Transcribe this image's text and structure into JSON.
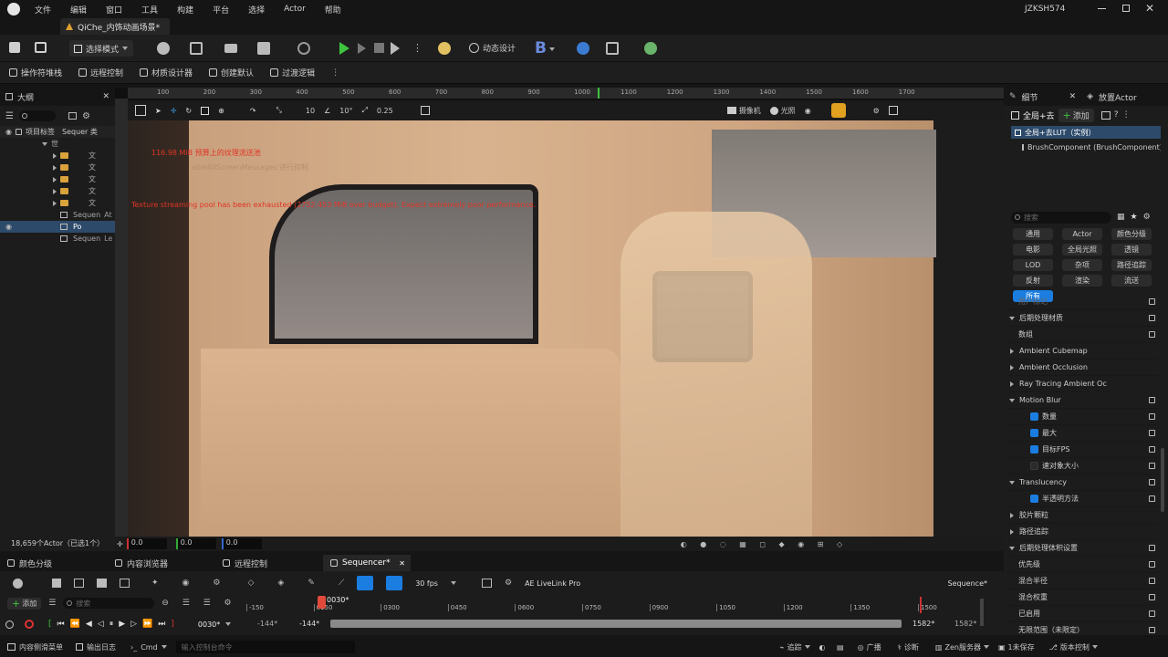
{
  "menu": [
    "文件",
    "编辑",
    "窗口",
    "工具",
    "构建",
    "平台",
    "选择",
    "Actor",
    "帮助"
  ],
  "user": "JZKSH574",
  "level_tab": "QiChe_内饰动画场景*",
  "toolbar1": {
    "mode": "选择模式",
    "dynamic_design": "动态设计"
  },
  "toolbar2": [
    "操作符堆栈",
    "远程控制",
    "材质设计器",
    "创建默认",
    "过渡逻辑"
  ],
  "outliner": {
    "title": "大纲",
    "col_label": "项目标签",
    "col_type": "Sequer 类",
    "rows": [
      {
        "label": "世",
        "indent": 0
      },
      {
        "label": "文",
        "indent": 1,
        "folder": true
      },
      {
        "label": "文",
        "indent": 1,
        "folder": true
      },
      {
        "label": "文",
        "indent": 1,
        "folder": true
      },
      {
        "label": "文",
        "indent": 1,
        "folder": true
      },
      {
        "label": "文",
        "indent": 1,
        "folder": true
      },
      {
        "label": "Sequen",
        "type": "At",
        "indent": 1
      },
      {
        "label": "Po",
        "indent": 1,
        "selected": true
      },
      {
        "label": "Sequen",
        "type": "Le",
        "indent": 1
      }
    ],
    "footer": "18,659个Actor（已选1个）"
  },
  "viewport": {
    "ruler": [
      "100",
      "200",
      "300",
      "400",
      "500",
      "600",
      "700",
      "800",
      "900",
      "1000",
      "1100",
      "1200",
      "1300",
      "1400",
      "1500",
      "1600",
      "1700"
    ],
    "camera_label": "摄像机",
    "lit_label": "光照",
    "snap_rot": "10°",
    "snap_grid": "10",
    "snap_scale": "0.25",
    "msg1": "116.98 MiB 预算上的纹理流送池",
    "msg2": "ableAllScreenMessages'进行抑制",
    "msg3": "Texture streaming pool has been exhausted (2752.453 MiB over budget). Expect extremely poor performance.",
    "coord_x": "0.0",
    "coord_y": "0.0",
    "coord_z": "0.0"
  },
  "details": {
    "tab1": "细节",
    "tab2": "放置Actor",
    "search_prefix": "全局+去",
    "add_label": "添加",
    "selected_item": "全局+去LUT（实例）",
    "component": "BrushComponent (BrushComponent)",
    "search_placeholder": "搜索",
    "chips": [
      "通用",
      "Actor",
      "颜色分级",
      "电影",
      "全局光照",
      "透镜",
      "LOD",
      "杂项",
      "路径追踪",
      "反射",
      "渲染",
      "流送",
      "所有"
    ],
    "props": [
      {
        "label": "用户标记",
        "kind": "plain",
        "dim": true
      },
      {
        "label": "后期处理材质",
        "kind": "section"
      },
      {
        "label": "数组",
        "kind": "plain"
      },
      {
        "label": "Ambient Cubemap",
        "kind": "collapsed"
      },
      {
        "label": "Ambient Occlusion",
        "kind": "collapsed"
      },
      {
        "label": "Ray Tracing Ambient Oc",
        "kind": "collapsed"
      },
      {
        "label": "Motion Blur",
        "kind": "section"
      },
      {
        "label": "数量",
        "kind": "check"
      },
      {
        "label": "最大",
        "kind": "check"
      },
      {
        "label": "目标FPS",
        "kind": "check"
      },
      {
        "label": "速对象大小",
        "kind": "check-off"
      },
      {
        "label": "Translucency",
        "kind": "section"
      },
      {
        "label": "半透明方法",
        "kind": "check"
      },
      {
        "label": "胶片颗粒",
        "kind": "collapsed"
      },
      {
        "label": "路径追踪",
        "kind": "collapsed"
      },
      {
        "label": "后期处理体积设置",
        "kind": "section"
      },
      {
        "label": "优先级",
        "kind": "plain"
      },
      {
        "label": "混合半径",
        "kind": "plain"
      },
      {
        "label": "混合权重",
        "kind": "plain"
      },
      {
        "label": "已启用",
        "kind": "plain"
      },
      {
        "label": "无限范围（未限定）",
        "kind": "plain"
      }
    ]
  },
  "bottom_tabs": [
    "颜色分级",
    "内容浏览器",
    "远程控制",
    "Sequencer*"
  ],
  "sequencer": {
    "add_label": "添加",
    "search_placeholder": "搜索",
    "fps": "30 fps",
    "livelink": "AE LiveLink Pro",
    "seq_name": "Sequence*",
    "playhead": "0030*",
    "frame_field": "0030*",
    "ticks": [
      "-150",
      "0150",
      "0300",
      "0450",
      "0600",
      "0750",
      "0900",
      "1050",
      "1200",
      "1350",
      "1500"
    ],
    "range_start1": "-144*",
    "range_start2": "-144*",
    "range_end1": "1582*",
    "range_end2": "1582*"
  },
  "status": {
    "content_drawer": "内容侧滑菜单",
    "output_log": "输出日志",
    "cmd": "Cmd",
    "cmd_placeholder": "输入控制台命令",
    "trace": "追踪",
    "broadcast": "广播",
    "diag": "诊断",
    "zen": "Zen服务器",
    "unsaved": "1未保存",
    "version": "版本控制"
  },
  "colors": {
    "accent": "#1b7de0",
    "play_green": "#3ec33e",
    "warning_red": "#d93a2a",
    "playhead": "#e04a3a"
  }
}
